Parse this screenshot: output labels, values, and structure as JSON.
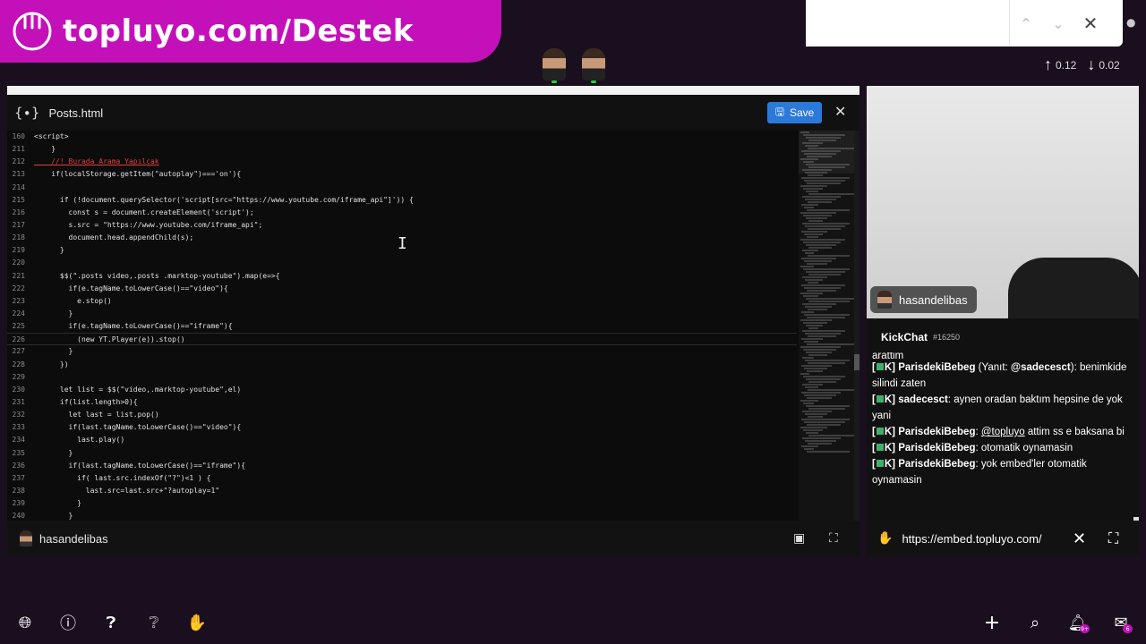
{
  "brand": {
    "text": "topluyo.com/Destek",
    "color": "#c410b8"
  },
  "findbar": {
    "value": "",
    "placeholder": "",
    "up_icon": "chevron-up-icon",
    "down_icon": "chevron-down-icon",
    "close_icon": "close-icon"
  },
  "netstats": {
    "upload": "0.12",
    "download": "0.02"
  },
  "editor": {
    "file_name": "Posts.html",
    "save_label": "Save",
    "lines": [
      {
        "n": "160",
        "t": "<script>"
      },
      {
        "n": "211",
        "t": "    }"
      },
      {
        "n": "212",
        "t": "    //! Burada Arama Yapılcak",
        "comment": true
      },
      {
        "n": "213",
        "t": "    if(localStorage.getItem(\"autoplay\")==='on'){"
      },
      {
        "n": "214",
        "t": ""
      },
      {
        "n": "215",
        "t": "      if (!document.querySelector('script[src=\"https://www.youtube.com/iframe_api\"]')) {"
      },
      {
        "n": "216",
        "t": "        const s = document.createElement('script');"
      },
      {
        "n": "217",
        "t": "        s.src = \"https://www.youtube.com/iframe_api\";"
      },
      {
        "n": "218",
        "t": "        document.head.appendChild(s);"
      },
      {
        "n": "219",
        "t": "      }"
      },
      {
        "n": "220",
        "t": ""
      },
      {
        "n": "221",
        "t": "      $$(\".posts video,.posts .marktop-youtube\").map(e=>{"
      },
      {
        "n": "222",
        "t": "        if(e.tagName.toLowerCase()==\"video\"){"
      },
      {
        "n": "223",
        "t": "          e.stop()"
      },
      {
        "n": "224",
        "t": "        }"
      },
      {
        "n": "225",
        "t": "        if(e.tagName.toLowerCase()==\"iframe\"){"
      },
      {
        "n": "226",
        "t": "          (new YT.Player(e)).stop()",
        "current": true
      },
      {
        "n": "227",
        "t": "        }"
      },
      {
        "n": "228",
        "t": "      })"
      },
      {
        "n": "229",
        "t": ""
      },
      {
        "n": "230",
        "t": "      let list = $$(\"video,.marktop-youtube\",el)"
      },
      {
        "n": "231",
        "t": "      if(list.length>0){"
      },
      {
        "n": "232",
        "t": "        let last = list.pop()"
      },
      {
        "n": "233",
        "t": "        if(last.tagName.toLowerCase()==\"video\"){"
      },
      {
        "n": "234",
        "t": "          last.play()"
      },
      {
        "n": "235",
        "t": "        }"
      },
      {
        "n": "236",
        "t": "        if(last.tagName.toLowerCase()==\"iframe\"){"
      },
      {
        "n": "237",
        "t": "          if( last.src.indexOf(\"?\")<1 ) {"
      },
      {
        "n": "238",
        "t": "            last.src=last.src+\"?autoplay=1\""
      },
      {
        "n": "239",
        "t": "          }"
      },
      {
        "n": "240",
        "t": "        }"
      }
    ],
    "footer_user": "hasandelibas"
  },
  "webcam": {
    "name": "hasandelibas"
  },
  "chat": {
    "title": "KickChat",
    "code": "#16250",
    "partial_line": "arattim",
    "messages": [
      {
        "user": "ParisdekiBebeg",
        "pre": " (Yanıt: ",
        "mention": "@sadecesct",
        "post": "): benimkide silindi zaten"
      },
      {
        "user": "sadecesct",
        "pre": ": aynen oradan baktım hepsine de yok yani",
        "mention": "",
        "post": ""
      },
      {
        "user": "ParisdekiBebeg",
        "pre": ":  ",
        "mention": "@topluyo",
        "post": "  attim ss e baksana bi"
      },
      {
        "user": "ParisdekiBebeg",
        "pre": ": otomatik oynamasin",
        "mention": "",
        "post": ""
      },
      {
        "user": "ParisdekiBebeg",
        "pre": ": yok embed'ler otomatik oynamasin",
        "mention": "",
        "post": ""
      }
    ]
  },
  "embed": {
    "url": "https://embed.topluyo.com/"
  },
  "bottom": {
    "notif_count": "9+",
    "mail_count": "6"
  }
}
